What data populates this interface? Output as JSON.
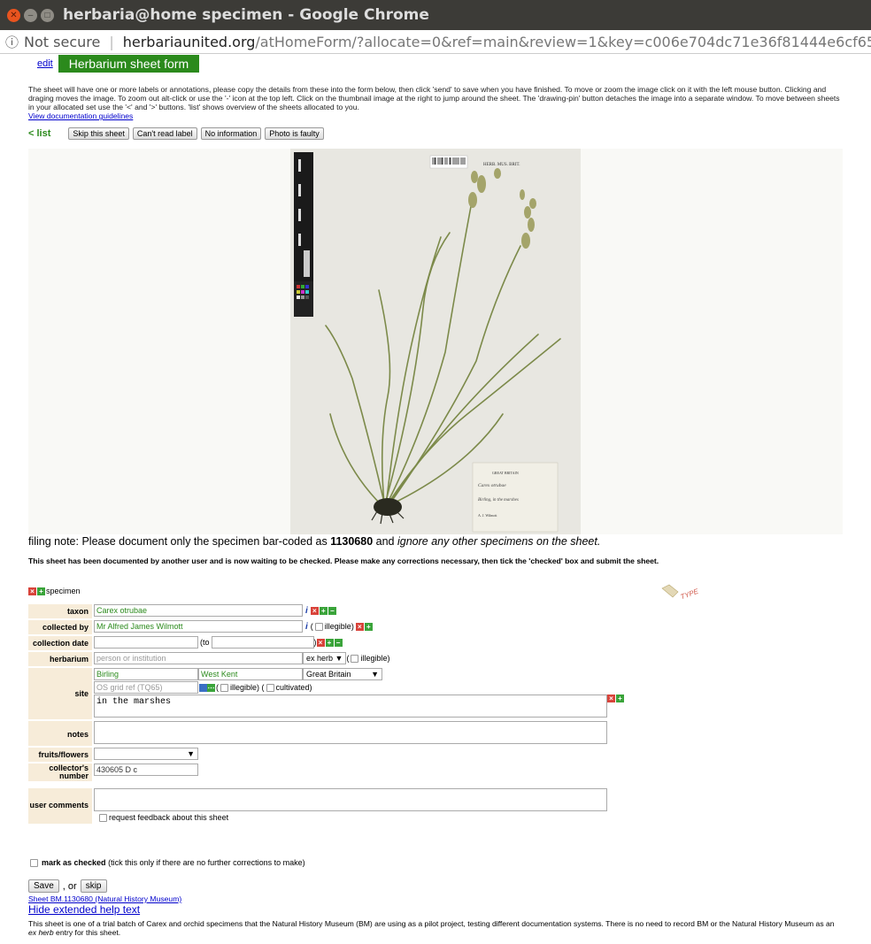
{
  "window": {
    "title": "herbaria@home specimen - Google Chrome"
  },
  "address": {
    "security": "Not secure",
    "domain": "herbariaunited.org",
    "path": "/atHomeForm/?allocate=0&ref=main&review=1&key=c006e704dc71e36f81444e6cf65bd7ed"
  },
  "header": {
    "edit_link": "edit",
    "form_title": "Herbarium sheet form"
  },
  "intro": {
    "text": "The sheet will have one or more labels or annotations, please copy the details from these into the form below, then click 'send' to save when you have finished. To move or zoom the image click on it with the left mouse button. Clicking and draging moves the image. To zoom out alt-click or use the '-' icon at the top left. Click on the thumbnail image at the right to jump around the sheet. The 'drawing-pin' button detaches the image into a separate window. To move between sheets in your allocated set use the '<' and '>' buttons. 'list' shows overview of the sheets allocated to you.",
    "doc_link": "View documentation guidelines"
  },
  "actions": {
    "list": "< list",
    "skip": "Skip this sheet",
    "cant_read": "Can't read label",
    "no_info": "No information",
    "faulty": "Photo is faulty"
  },
  "sheet_label": {
    "herb": "HERB. MUS. BRIT.",
    "country": "GREAT BRITAIN",
    "species": "Carex otrubae",
    "place": "Birling, in the marshes",
    "collector": "A. J. Wilmott"
  },
  "filing": {
    "prefix": "filing note: Please document only the specimen bar-coded as ",
    "barcode": "1130680",
    "mid": " and ",
    "suffix": "ignore any other specimens on the sheet."
  },
  "notice": "This sheet has been documented by another user and is now waiting to be checked. Please make any corrections necessary, then tick the 'checked' box and submit the sheet.",
  "specimen_label": "specimen",
  "form": {
    "taxon": {
      "label": "taxon",
      "value": "Carex otrubae"
    },
    "collected_by": {
      "label": "collected by",
      "value": "Mr Alfred James Wilmott",
      "illegible": "illegible"
    },
    "collection_date": {
      "label": "collection date",
      "to": "(to"
    },
    "herbarium": {
      "label": "herbarium",
      "placeholder": "person or institution",
      "select": "ex herb",
      "illegible": "illegible)"
    },
    "site": {
      "label": "site",
      "locality": "Birling",
      "county": "West Kent",
      "country": "Great Britain",
      "grid_placeholder": "OS grid ref (TQ65)",
      "illegible": "illegible)",
      "cultivated": "cultivated)",
      "text": "in the marshes"
    },
    "notes": {
      "label": "notes"
    },
    "fruits": {
      "label": "fruits/flowers"
    },
    "collector_number": {
      "label": "collector's number",
      "value": "430605 D c"
    },
    "user_comments": {
      "label": "user comments",
      "feedback": "request feedback about this sheet"
    }
  },
  "checked": {
    "bold": "mark as checked",
    "rest": "(tick this only if there are no further corrections to make)"
  },
  "save": {
    "save": "Save",
    "or": ", or",
    "skip": "skip"
  },
  "links": {
    "sheet": "Sheet BM.1130680 (Natural History Museum)",
    "hide": "Hide extended help text"
  },
  "footer": {
    "pre": "This sheet is one of a trial batch of Carex and orchid specimens that the Natural History Museum (BM) are using as a pilot project, testing different documentation systems. There is no need to record BM or the Natural History Museum as an ",
    "em": "ex herb",
    "post": " entry for this sheet."
  }
}
